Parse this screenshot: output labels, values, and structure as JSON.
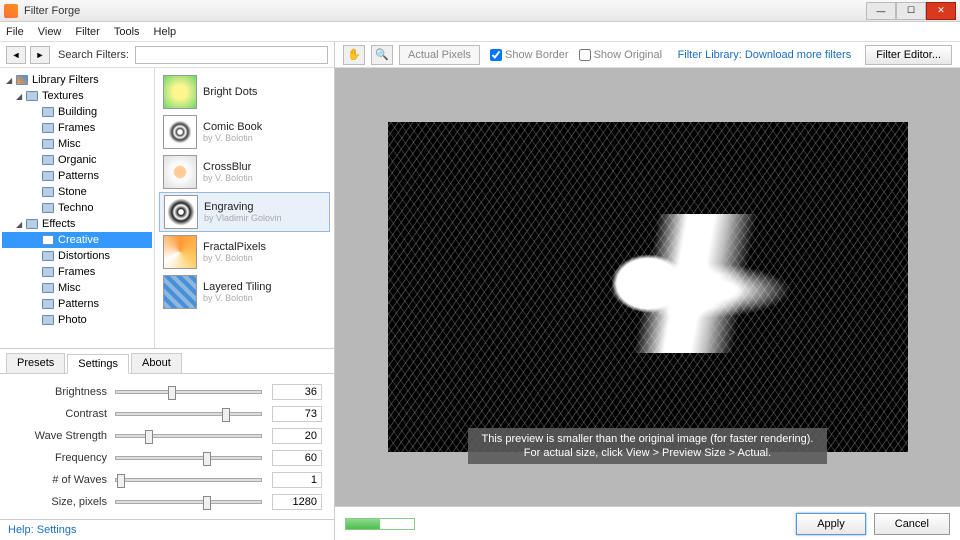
{
  "window": {
    "title": "Filter Forge"
  },
  "menu": [
    "File",
    "View",
    "Filter",
    "Tools",
    "Help"
  ],
  "search": {
    "label": "Search Filters:",
    "value": ""
  },
  "tree": {
    "root": "Library Filters",
    "textures": {
      "label": "Textures",
      "children": [
        "Building",
        "Frames",
        "Misc",
        "Organic",
        "Patterns",
        "Stone",
        "Techno"
      ]
    },
    "effects": {
      "label": "Effects",
      "children": [
        "Creative",
        "Distortions",
        "Frames",
        "Misc",
        "Patterns",
        "Photo"
      ]
    },
    "selected": "Creative"
  },
  "filters": [
    {
      "name": "Bright Dots",
      "author": ""
    },
    {
      "name": "Comic Book",
      "author": "by V. Bolotin"
    },
    {
      "name": "CrossBlur",
      "author": "by V. Bolotin"
    },
    {
      "name": "Engraving",
      "author": "by Vladimir Golovin"
    },
    {
      "name": "FractalPixels",
      "author": "by V. Bolotin"
    },
    {
      "name": "Layered Tiling",
      "author": "by V. Bolotin"
    }
  ],
  "filters_selected": 3,
  "tabs": [
    "Presets",
    "Settings",
    "About"
  ],
  "tabs_active": 1,
  "settings": [
    {
      "label": "Brightness",
      "value": 36,
      "pos": 36
    },
    {
      "label": "Contrast",
      "value": 73,
      "pos": 73
    },
    {
      "label": "Wave Strength",
      "value": 20,
      "pos": 20
    },
    {
      "label": "Frequency",
      "value": 60,
      "pos": 60
    },
    {
      "label": "# of Waves",
      "value": 1,
      "pos": 1
    },
    {
      "label": "Size, pixels",
      "value": 1280,
      "pos": 60
    }
  ],
  "help": "Help: Settings",
  "toolbar": {
    "actual_pixels": "Actual Pixels",
    "show_border": "Show Border",
    "show_original": "Show Original",
    "library_link": "Filter Library: Download more filters",
    "editor": "Filter Editor..."
  },
  "preview_note_l1": "This preview is smaller than the original image (for faster rendering).",
  "preview_note_l2": "For actual size, click View > Preview Size > Actual.",
  "buttons": {
    "apply": "Apply",
    "cancel": "Cancel"
  }
}
